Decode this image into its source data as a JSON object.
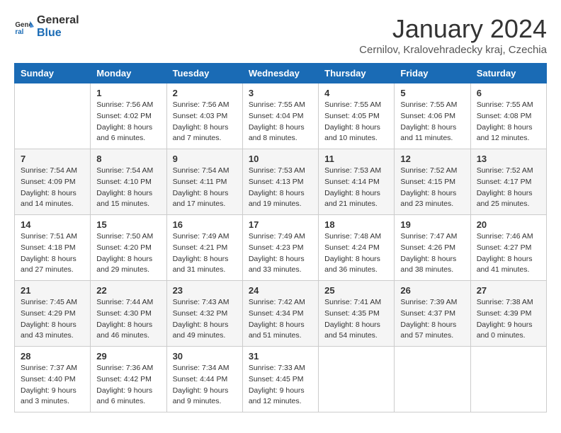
{
  "logo": {
    "line1": "General",
    "line2": "Blue"
  },
  "title": "January 2024",
  "subtitle": "Cernilov, Kralovehradecky kraj, Czechia",
  "weekdays": [
    "Sunday",
    "Monday",
    "Tuesday",
    "Wednesday",
    "Thursday",
    "Friday",
    "Saturday"
  ],
  "weeks": [
    [
      null,
      {
        "day": 1,
        "sunrise": "7:56 AM",
        "sunset": "4:02 PM",
        "daylight": "8 hours and 6 minutes."
      },
      {
        "day": 2,
        "sunrise": "7:56 AM",
        "sunset": "4:03 PM",
        "daylight": "8 hours and 7 minutes."
      },
      {
        "day": 3,
        "sunrise": "7:55 AM",
        "sunset": "4:04 PM",
        "daylight": "8 hours and 8 minutes."
      },
      {
        "day": 4,
        "sunrise": "7:55 AM",
        "sunset": "4:05 PM",
        "daylight": "8 hours and 10 minutes."
      },
      {
        "day": 5,
        "sunrise": "7:55 AM",
        "sunset": "4:06 PM",
        "daylight": "8 hours and 11 minutes."
      },
      {
        "day": 6,
        "sunrise": "7:55 AM",
        "sunset": "4:08 PM",
        "daylight": "8 hours and 12 minutes."
      }
    ],
    [
      {
        "day": 7,
        "sunrise": "7:54 AM",
        "sunset": "4:09 PM",
        "daylight": "8 hours and 14 minutes."
      },
      {
        "day": 8,
        "sunrise": "7:54 AM",
        "sunset": "4:10 PM",
        "daylight": "8 hours and 15 minutes."
      },
      {
        "day": 9,
        "sunrise": "7:54 AM",
        "sunset": "4:11 PM",
        "daylight": "8 hours and 17 minutes."
      },
      {
        "day": 10,
        "sunrise": "7:53 AM",
        "sunset": "4:13 PM",
        "daylight": "8 hours and 19 minutes."
      },
      {
        "day": 11,
        "sunrise": "7:53 AM",
        "sunset": "4:14 PM",
        "daylight": "8 hours and 21 minutes."
      },
      {
        "day": 12,
        "sunrise": "7:52 AM",
        "sunset": "4:15 PM",
        "daylight": "8 hours and 23 minutes."
      },
      {
        "day": 13,
        "sunrise": "7:52 AM",
        "sunset": "4:17 PM",
        "daylight": "8 hours and 25 minutes."
      }
    ],
    [
      {
        "day": 14,
        "sunrise": "7:51 AM",
        "sunset": "4:18 PM",
        "daylight": "8 hours and 27 minutes."
      },
      {
        "day": 15,
        "sunrise": "7:50 AM",
        "sunset": "4:20 PM",
        "daylight": "8 hours and 29 minutes."
      },
      {
        "day": 16,
        "sunrise": "7:49 AM",
        "sunset": "4:21 PM",
        "daylight": "8 hours and 31 minutes."
      },
      {
        "day": 17,
        "sunrise": "7:49 AM",
        "sunset": "4:23 PM",
        "daylight": "8 hours and 33 minutes."
      },
      {
        "day": 18,
        "sunrise": "7:48 AM",
        "sunset": "4:24 PM",
        "daylight": "8 hours and 36 minutes."
      },
      {
        "day": 19,
        "sunrise": "7:47 AM",
        "sunset": "4:26 PM",
        "daylight": "8 hours and 38 minutes."
      },
      {
        "day": 20,
        "sunrise": "7:46 AM",
        "sunset": "4:27 PM",
        "daylight": "8 hours and 41 minutes."
      }
    ],
    [
      {
        "day": 21,
        "sunrise": "7:45 AM",
        "sunset": "4:29 PM",
        "daylight": "8 hours and 43 minutes."
      },
      {
        "day": 22,
        "sunrise": "7:44 AM",
        "sunset": "4:30 PM",
        "daylight": "8 hours and 46 minutes."
      },
      {
        "day": 23,
        "sunrise": "7:43 AM",
        "sunset": "4:32 PM",
        "daylight": "8 hours and 49 minutes."
      },
      {
        "day": 24,
        "sunrise": "7:42 AM",
        "sunset": "4:34 PM",
        "daylight": "8 hours and 51 minutes."
      },
      {
        "day": 25,
        "sunrise": "7:41 AM",
        "sunset": "4:35 PM",
        "daylight": "8 hours and 54 minutes."
      },
      {
        "day": 26,
        "sunrise": "7:39 AM",
        "sunset": "4:37 PM",
        "daylight": "8 hours and 57 minutes."
      },
      {
        "day": 27,
        "sunrise": "7:38 AM",
        "sunset": "4:39 PM",
        "daylight": "9 hours and 0 minutes."
      }
    ],
    [
      {
        "day": 28,
        "sunrise": "7:37 AM",
        "sunset": "4:40 PM",
        "daylight": "9 hours and 3 minutes."
      },
      {
        "day": 29,
        "sunrise": "7:36 AM",
        "sunset": "4:42 PM",
        "daylight": "9 hours and 6 minutes."
      },
      {
        "day": 30,
        "sunrise": "7:34 AM",
        "sunset": "4:44 PM",
        "daylight": "9 hours and 9 minutes."
      },
      {
        "day": 31,
        "sunrise": "7:33 AM",
        "sunset": "4:45 PM",
        "daylight": "9 hours and 12 minutes."
      },
      null,
      null,
      null
    ]
  ]
}
